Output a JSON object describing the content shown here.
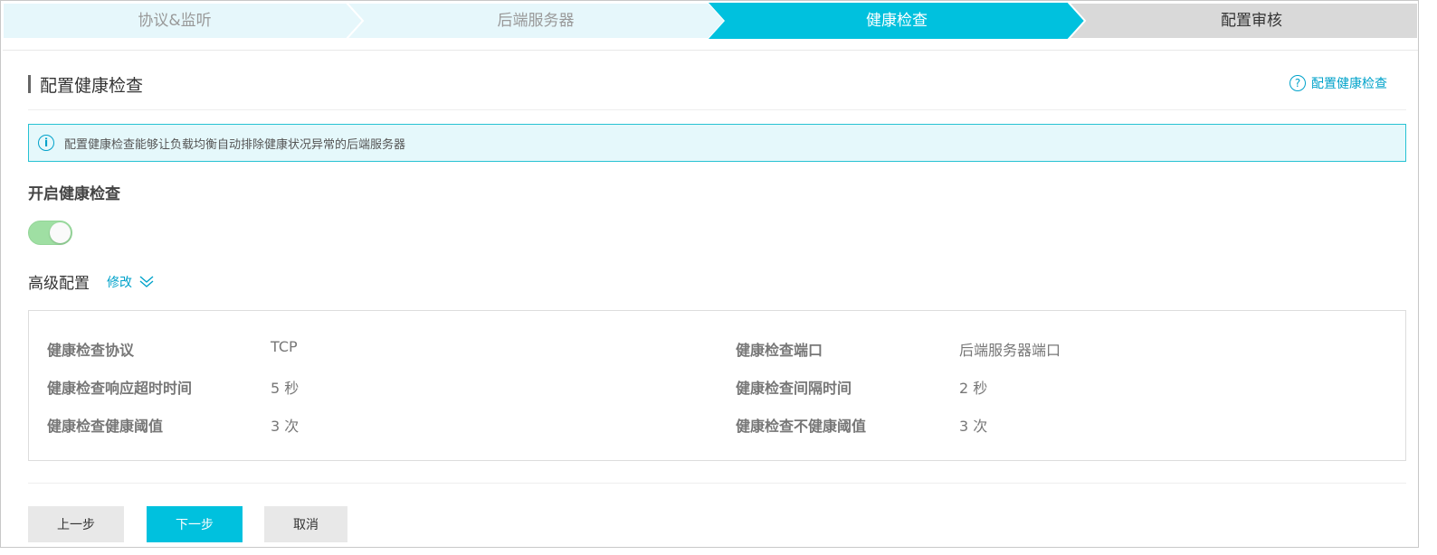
{
  "steps": [
    {
      "label": "协议&监听",
      "state": "done"
    },
    {
      "label": "后端服务器",
      "state": "done"
    },
    {
      "label": "健康检查",
      "state": "active"
    },
    {
      "label": "配置审核",
      "state": "pending"
    }
  ],
  "colors": {
    "step_done_bg": "#e6f7fb",
    "step_active_bg": "#00c1de",
    "step_pending_bg": "#d9d9d9",
    "accent": "#00a2ca",
    "toggle_on": "#9fdfa3"
  },
  "section": {
    "title": "配置健康检查",
    "help_link": "配置健康检查",
    "help_icon": "question-circle-icon"
  },
  "notice": {
    "icon": "info-circle-icon",
    "text": "配置健康检查能够让负载均衡自动排除健康状况异常的后端服务器"
  },
  "enable": {
    "label": "开启健康检查",
    "on": true
  },
  "advanced": {
    "label": "高级配置",
    "edit_label": "修改"
  },
  "config": {
    "left": [
      {
        "key": "健康检查协议",
        "value": "TCP"
      },
      {
        "key": "健康检查响应超时时间",
        "value": "5 秒"
      },
      {
        "key": "健康检查健康阈值",
        "value": "3 次"
      }
    ],
    "right": [
      {
        "key": "健康检查端口",
        "value": "后端服务器端口"
      },
      {
        "key": "健康检查间隔时间",
        "value": "2 秒"
      },
      {
        "key": "健康检查不健康阈值",
        "value": "3 次"
      }
    ]
  },
  "buttons": {
    "prev": "上一步",
    "next": "下一步",
    "cancel": "取消"
  }
}
